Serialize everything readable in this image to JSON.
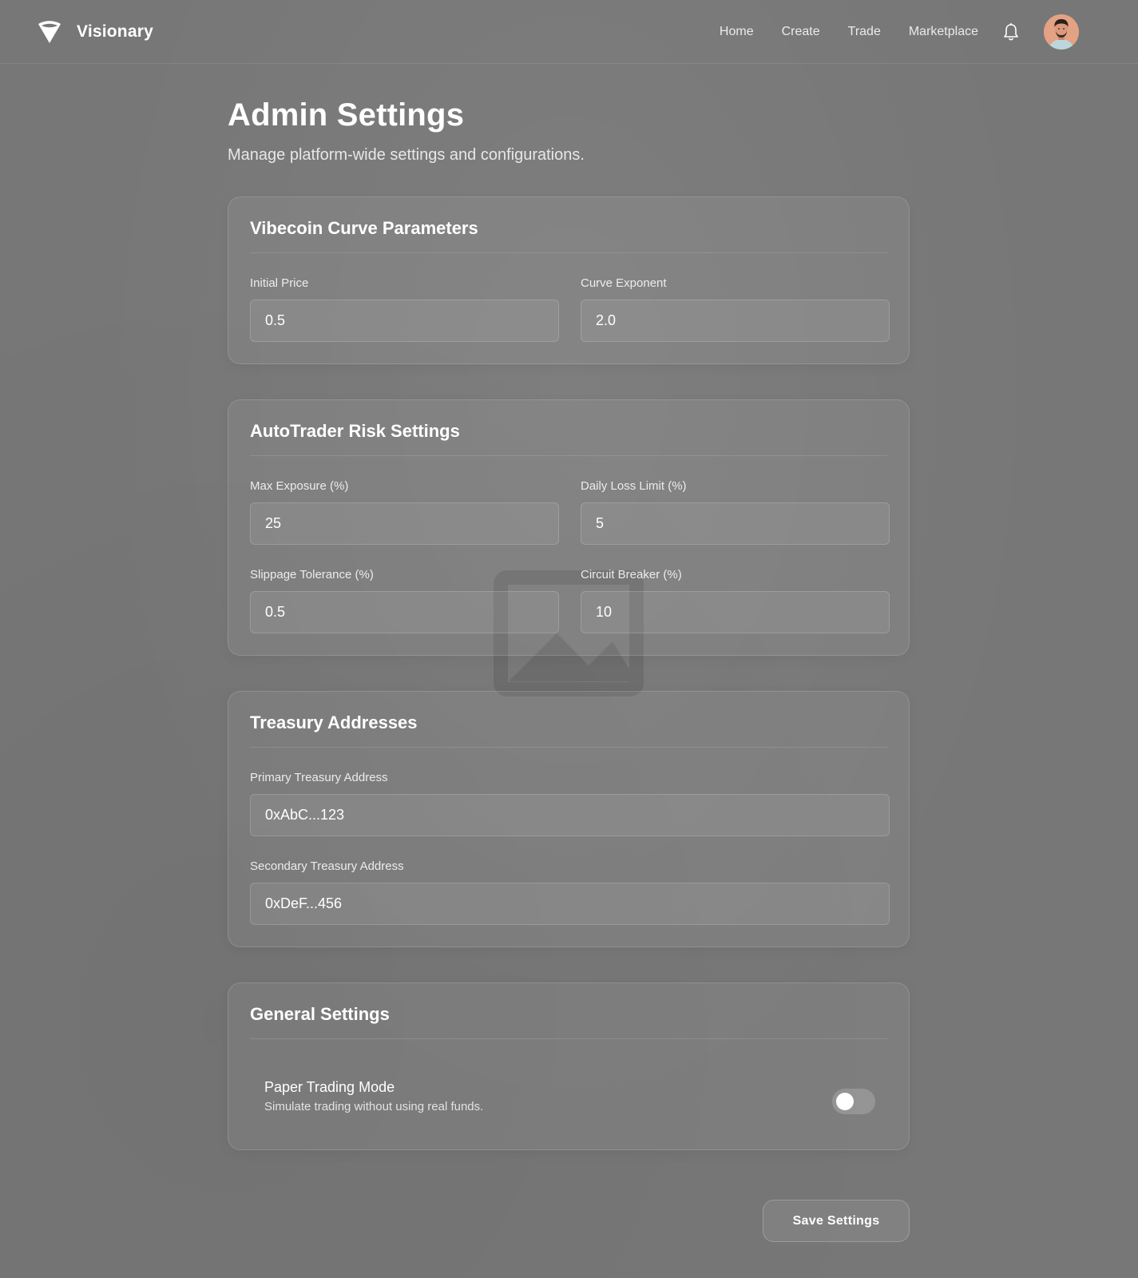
{
  "app": {
    "name": "Visionary",
    "logo_icon": "funnel-logo-icon"
  },
  "nav": {
    "items": [
      {
        "label": "Home"
      },
      {
        "label": "Create"
      },
      {
        "label": "Trade"
      },
      {
        "label": "Marketplace"
      }
    ],
    "notification_icon": "bell-icon",
    "avatar_icon": "user-avatar"
  },
  "page": {
    "title": "Admin Settings",
    "subtitle": "Manage platform-wide settings and configurations."
  },
  "sections": {
    "curve": {
      "title": "Vibecoin Curve Parameters",
      "initial_price": {
        "label": "Initial Price",
        "value": "0.5"
      },
      "curve_exponent": {
        "label": "Curve Exponent",
        "value": "2.0"
      }
    },
    "risk": {
      "title": "AutoTrader Risk Settings",
      "max_exposure": {
        "label": "Max Exposure (%)",
        "value": "25"
      },
      "daily_loss_limit": {
        "label": "Daily Loss Limit (%)",
        "value": "5"
      },
      "slippage_tolerance": {
        "label": "Slippage Tolerance (%)",
        "value": "0.5"
      },
      "circuit_breaker": {
        "label": "Circuit Breaker (%)",
        "value": "10"
      }
    },
    "treasury": {
      "title": "Treasury Addresses",
      "primary": {
        "label": "Primary Treasury Address",
        "value": "0xAbC...123"
      },
      "secondary": {
        "label": "Secondary Treasury Address",
        "value": "0xDeF...456"
      }
    },
    "general": {
      "title": "General Settings",
      "paper_trading": {
        "title": "Paper Trading Mode",
        "description": "Simulate trading without using real funds.",
        "enabled": false
      }
    }
  },
  "actions": {
    "save_label": "Save Settings"
  },
  "colors": {
    "background": "#777777",
    "text": "#ffffff"
  }
}
